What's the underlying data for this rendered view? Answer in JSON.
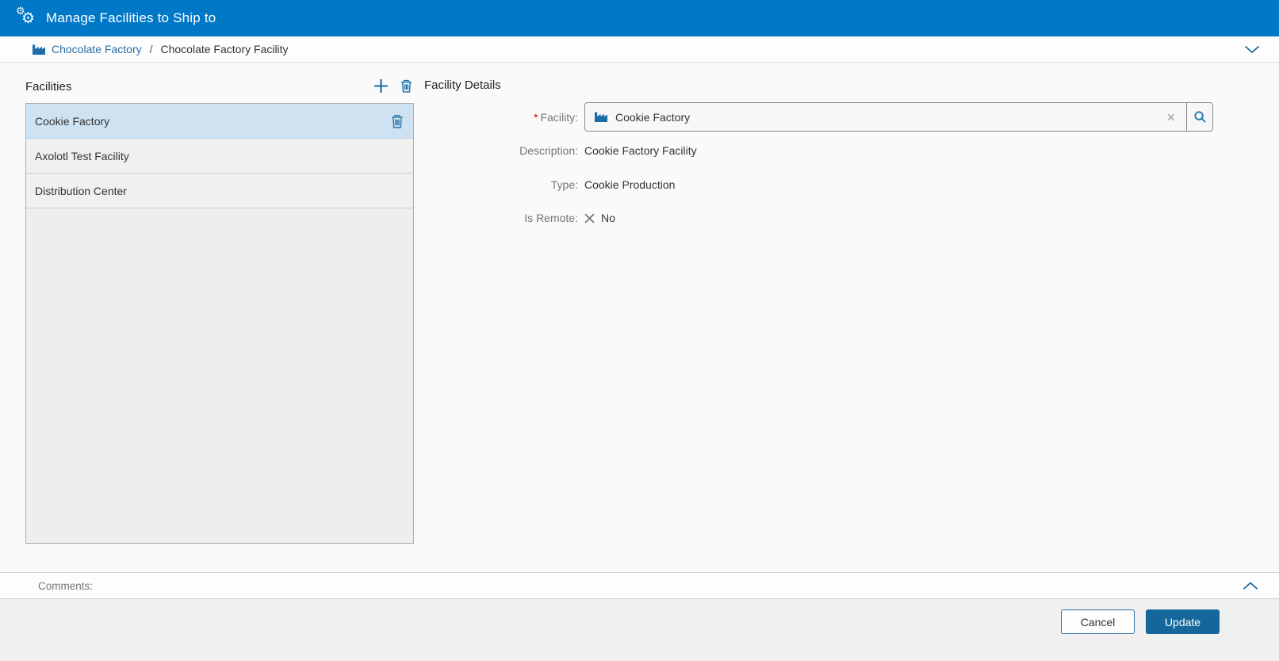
{
  "window": {
    "title": "Manage Facilities to Ship to"
  },
  "colors": {
    "titlebar_blue": "#0078c8",
    "accent_blue": "#1b6ca8",
    "link_blue": "#2a6da4",
    "selected_row_blue": "#cfe2f1",
    "update_button_blue": "#15679b",
    "required_red": "#cc0000",
    "label_gray": "#767676"
  },
  "icons": {
    "cogs_glyph": "⚙",
    "clear_glyph": "×",
    "plus": "plus-icon",
    "trash": "trash-icon",
    "factory": "factory-icon",
    "search": "magnifier-icon",
    "chevron_down": "chevron-down-icon",
    "chevron_up": "chevron-up-icon",
    "x_mark": "x-mark-icon"
  },
  "breadcrumb": {
    "root": "Chocolate Factory",
    "separator": "/",
    "current": "Chocolate Factory Facility"
  },
  "facilities_panel": {
    "title": "Facilities",
    "items": [
      {
        "label": "Cookie Factory",
        "selected": true
      },
      {
        "label": "Axolotl Test Facility",
        "selected": false
      },
      {
        "label": "Distribution Center",
        "selected": false
      }
    ]
  },
  "details_panel": {
    "title": "Facility Details",
    "facility": {
      "label": "Facility:",
      "required_marker": "*",
      "value": "Cookie Factory",
      "clear_glyph": "×"
    },
    "description": {
      "label": "Description:",
      "value": "Cookie Factory Facility"
    },
    "type": {
      "label": "Type:",
      "value": "Cookie Production"
    },
    "is_remote": {
      "label": "Is Remote:",
      "value": "No"
    }
  },
  "comments": {
    "label": "Comments:"
  },
  "footer": {
    "cancel_label": "Cancel",
    "update_label": "Update"
  }
}
